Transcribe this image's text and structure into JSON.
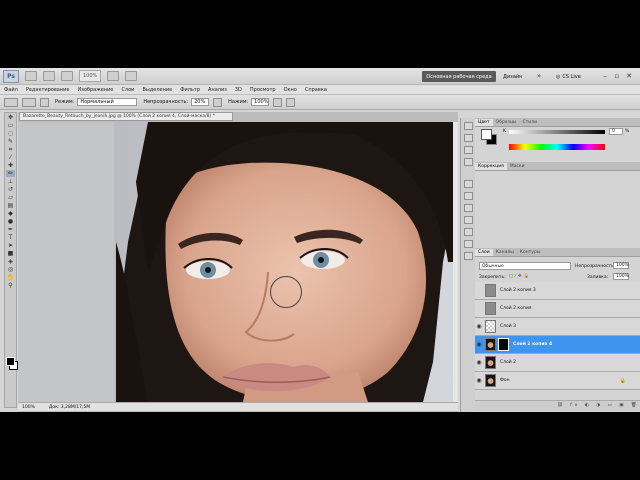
{
  "app": {
    "logo": "Ps",
    "zoom": "100%",
    "workspace_active": "Основная рабочая среда",
    "workspace_design": "Дизайн",
    "cs_live": "CS Live"
  },
  "menu": [
    "Файл",
    "Редактирование",
    "Изображение",
    "Слои",
    "Выделение",
    "Фильтр",
    "Анализ",
    "3D",
    "Просмотр",
    "Окно",
    "Справка"
  ],
  "options": {
    "mode_label": "Режим:",
    "mode_value": "Нормальный",
    "opacity_label": "Непрозрачность:",
    "opacity_value": "20%",
    "pressure_label": "Нажим:",
    "pressure_value": "100%"
  },
  "document": {
    "tab_title": "Bazarette_Beauty_Retouch_by_jeanih.jpg @ 100% (Слой 2 копия 4, Слой-маска/8) *",
    "status_zoom": "100%",
    "status_doc": "Док: 3,28M/17,5M"
  },
  "color_panel": {
    "tabs": [
      "Цвет",
      "Образцы",
      "Стили"
    ],
    "k_label": "K",
    "k_value": "0",
    "k_unit": "%"
  },
  "adjust_panel": {
    "tabs": [
      "Коррекция",
      "Маски"
    ]
  },
  "layers_panel": {
    "tabs": [
      "Слои",
      "Каналы",
      "Контуры"
    ],
    "blend_mode": "Обычные",
    "opacity_label": "Непрозрачность:",
    "opacity_value": "100%",
    "lock_label": "Закрепить:",
    "fill_label": "Заливка:",
    "fill_value": "100%",
    "layers": [
      {
        "name": "Слой 2 копия 3",
        "visible": false,
        "selected": false,
        "thumb": "gray"
      },
      {
        "name": "Слой 2 копия",
        "visible": false,
        "selected": false,
        "thumb": "gray"
      },
      {
        "name": "Слой 3",
        "visible": true,
        "selected": false,
        "thumb": "checker"
      },
      {
        "name": "Слой 2 копия 4",
        "visible": true,
        "selected": true,
        "thumb": "photo",
        "mask": true
      },
      {
        "name": "Слой 2",
        "visible": true,
        "selected": false,
        "thumb": "photo"
      },
      {
        "name": "Фон",
        "visible": true,
        "selected": false,
        "thumb": "photo",
        "locked": true
      }
    ]
  },
  "colors": {
    "selection": "#3d95ee",
    "workspace_button": "#5a5a5a"
  }
}
